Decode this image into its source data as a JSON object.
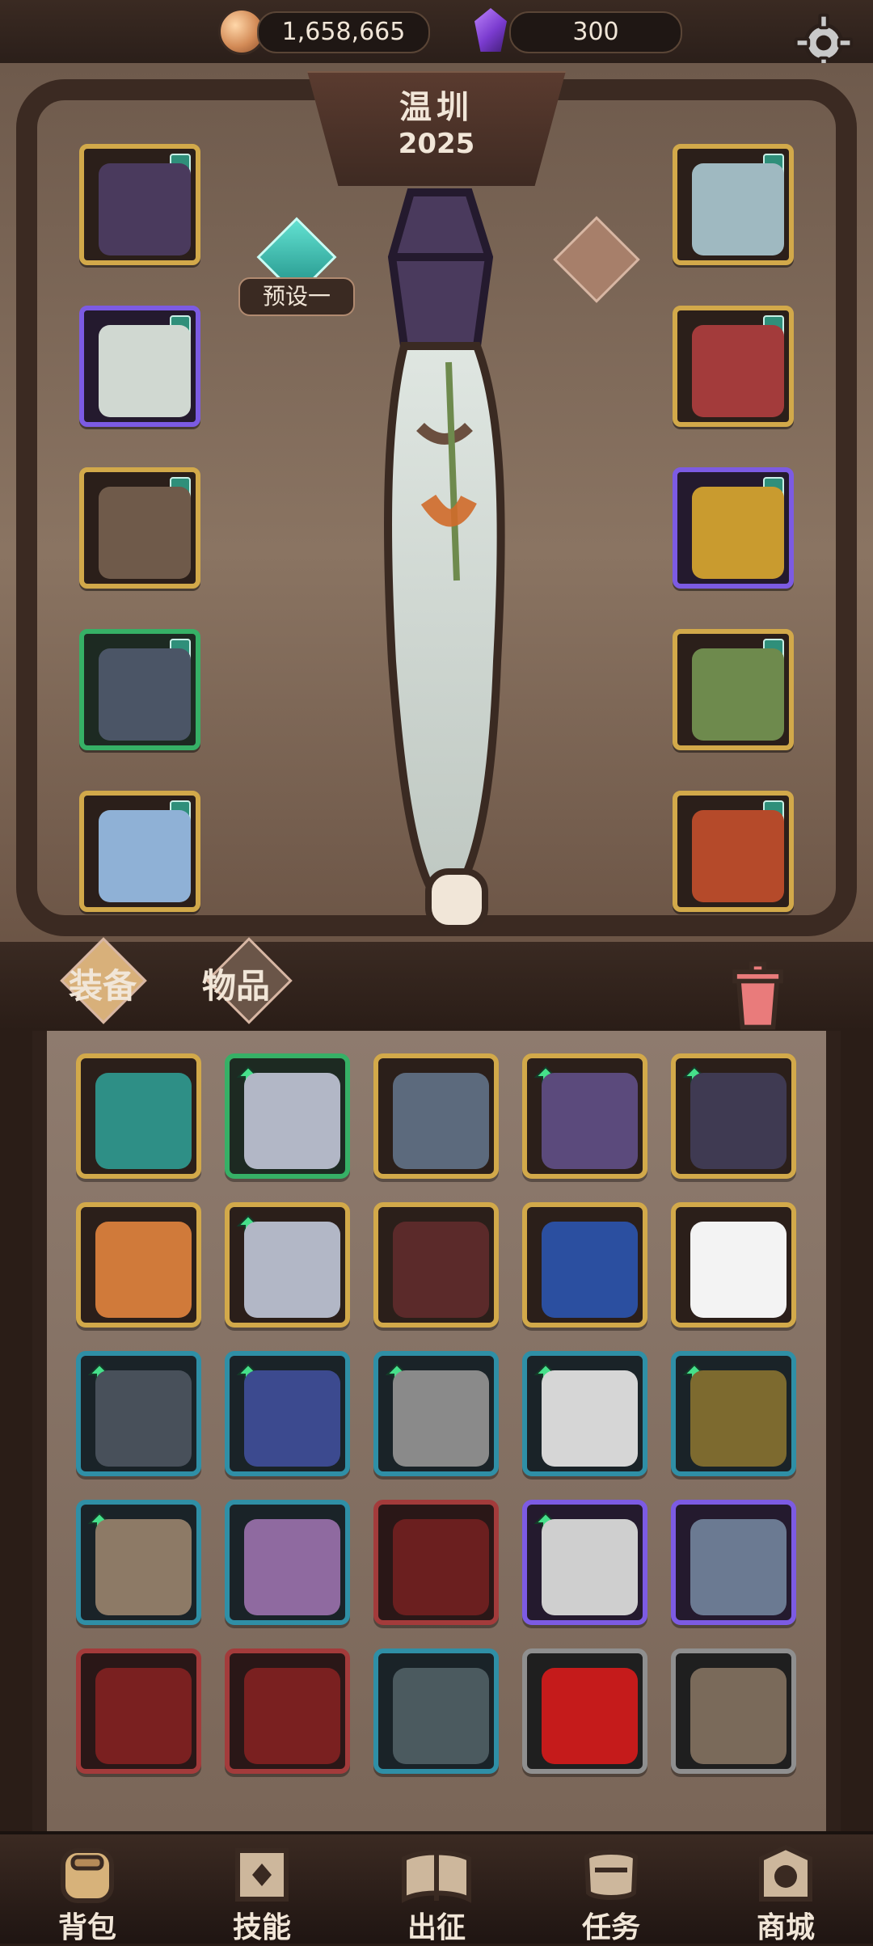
{
  "currency": {
    "gold": "1,658,665",
    "gems": "300"
  },
  "header": {
    "character_name": "温圳",
    "character_year": "2025",
    "preset_label": "预设一"
  },
  "tabs": [
    {
      "key": "equipment",
      "label": "装备"
    },
    {
      "key": "items",
      "label": "物品"
    }
  ],
  "bottom_nav": [
    {
      "key": "backpack",
      "label": "背包"
    },
    {
      "key": "skills",
      "label": "技能"
    },
    {
      "key": "sortie",
      "label": "出征"
    },
    {
      "key": "tasks",
      "label": "任务"
    },
    {
      "key": "shop",
      "label": "商城"
    }
  ],
  "equipment_slots": [
    {
      "side": "left",
      "row": 0,
      "rarity": "gold",
      "icon": "cage-helm-icon",
      "color": "#4a3a5d"
    },
    {
      "side": "left",
      "row": 1,
      "rarity": "purple",
      "icon": "tunic-icon",
      "color": "#d0d8d1"
    },
    {
      "side": "left",
      "row": 2,
      "rarity": "gold",
      "icon": "gloves-icon",
      "color": "#6f5a4a"
    },
    {
      "side": "left",
      "row": 3,
      "rarity": "green",
      "icon": "skirt-icon",
      "color": "#4b5566"
    },
    {
      "side": "left",
      "row": 4,
      "rarity": "gold",
      "icon": "boots-icon",
      "color": "#8fb1d6"
    },
    {
      "side": "right",
      "row": 0,
      "rarity": "gold",
      "icon": "amulet-icon",
      "color": "#9fb9c1"
    },
    {
      "side": "right",
      "row": 1,
      "rarity": "gold",
      "icon": "cloak-icon",
      "color": "#a33b3b"
    },
    {
      "side": "right",
      "row": 2,
      "rarity": "purple",
      "icon": "ring-icon",
      "color": "#c99b2f"
    },
    {
      "side": "right",
      "row": 3,
      "rarity": "gold",
      "icon": "staff-icon",
      "color": "#6e8a4d"
    },
    {
      "side": "right",
      "row": 4,
      "rarity": "gold",
      "icon": "spellbook-icon",
      "color": "#b54a2a"
    }
  ],
  "inventory": [
    {
      "rarity": "gold",
      "icon": "necklace-icon",
      "upgrade": false,
      "color": "#2e8f86"
    },
    {
      "rarity": "green",
      "icon": "bracelet-icon",
      "upgrade": true,
      "color": "#b2b7c6"
    },
    {
      "rarity": "gold",
      "icon": "cowl-icon",
      "upgrade": false,
      "color": "#5c6a7d"
    },
    {
      "rarity": "gold",
      "icon": "helmet-icon",
      "upgrade": true,
      "color": "#5b4a7c"
    },
    {
      "rarity": "gold",
      "icon": "boots-icon",
      "upgrade": true,
      "color": "#3f3a52"
    },
    {
      "rarity": "gold",
      "icon": "pendant-icon",
      "upgrade": false,
      "color": "#d07a3a"
    },
    {
      "rarity": "gold",
      "icon": "anchor-icon",
      "upgrade": true,
      "color": "#b2b7c6"
    },
    {
      "rarity": "gold",
      "icon": "robe-icon",
      "upgrade": false,
      "color": "#5b2a2a"
    },
    {
      "rarity": "gold",
      "icon": "heart-icon",
      "upgrade": false,
      "color": "#2b4fa0"
    },
    {
      "rarity": "gold",
      "icon": "hat-icon",
      "upgrade": false,
      "color": "#f3f3f3"
    },
    {
      "rarity": "teal",
      "icon": "cape-icon",
      "upgrade": true,
      "color": "#48505a"
    },
    {
      "rarity": "teal",
      "icon": "staff-icon",
      "upgrade": true,
      "color": "#3c4a8f"
    },
    {
      "rarity": "teal",
      "icon": "wand-icon",
      "upgrade": true,
      "color": "#8a8a8a"
    },
    {
      "rarity": "teal",
      "icon": "gauntlet-icon",
      "upgrade": true,
      "color": "#d6d6d6"
    },
    {
      "rarity": "teal",
      "icon": "scepter-icon",
      "upgrade": true,
      "color": "#7d6a2f"
    },
    {
      "rarity": "teal",
      "icon": "spear-icon",
      "upgrade": true,
      "color": "#8d7a66"
    },
    {
      "rarity": "teal",
      "icon": "charm-icon",
      "upgrade": false,
      "color": "#8f6aa0"
    },
    {
      "rarity": "red",
      "icon": "sword-icon",
      "upgrade": false,
      "color": "#6b1f1f"
    },
    {
      "rarity": "purple",
      "icon": "pants-icon",
      "upgrade": true,
      "color": "#cfcfcf"
    },
    {
      "rarity": "purple",
      "icon": "talisman-icon",
      "upgrade": false,
      "color": "#6b7a92"
    },
    {
      "rarity": "red",
      "icon": "red-boots-icon",
      "upgrade": false,
      "color": "#7a2020"
    },
    {
      "rarity": "red",
      "icon": "dagger-icon",
      "upgrade": false,
      "color": "#7a2020"
    },
    {
      "rarity": "teal",
      "icon": "coat-icon",
      "upgrade": false,
      "color": "#4b5a5f"
    },
    {
      "rarity": "grey",
      "icon": "red-heart-icon",
      "upgrade": false,
      "color": "#c51b1b"
    },
    {
      "rarity": "grey",
      "icon": "spear-icon",
      "upgrade": false,
      "color": "#7a6a5a"
    }
  ]
}
